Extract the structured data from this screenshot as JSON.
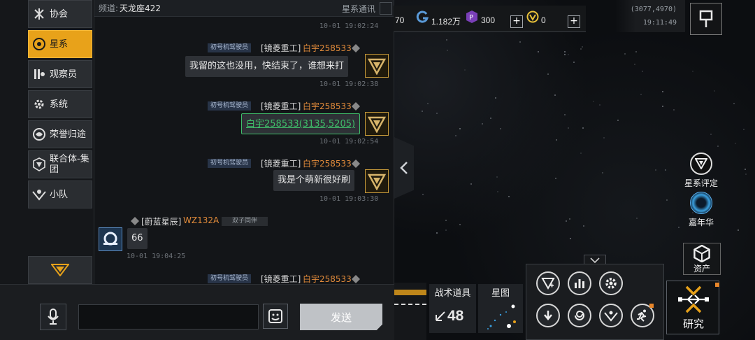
{
  "sidebar": {
    "items": [
      {
        "label": "协会",
        "icon": "alliance-star-icon"
      },
      {
        "label": "星系",
        "icon": "galaxy-icon"
      },
      {
        "label": "观察员",
        "icon": "observer-icon"
      },
      {
        "label": "系统",
        "icon": "gear-icon"
      },
      {
        "label": "荣誉归途",
        "icon": "honor-icon"
      },
      {
        "label": "联合体-集团",
        "icon": "union-icon"
      },
      {
        "label": "小队",
        "icon": "squad-icon"
      }
    ],
    "active_index": 1
  },
  "chat": {
    "channel_prefix": "频道:",
    "channel_name": "天龙座422",
    "channel_type": "星系通讯",
    "messages": [
      {
        "time": "10-01 19:02:24"
      },
      {
        "rank": "初号机驾驶员",
        "guild": "[镜菱重工]",
        "user": "白宇258533",
        "text": "我留的这也没用，快结束了，谁想来打",
        "time": "10-01 19:02:38"
      },
      {
        "rank": "初号机驾驶员",
        "guild": "[镜菱重工]",
        "user": "白宇258533",
        "text": "白宇258533(3135,5205)",
        "time": "10-01 19:02:54"
      },
      {
        "rank": "初号机驾驶员",
        "guild": "[镜菱重工]",
        "user": "白宇258533",
        "text": "我是个萌新很好刷",
        "time": "10-01 19:03:30"
      },
      {
        "guild": "[蔚蓝星辰]",
        "user": "WZ132A",
        "rank": "双子同伴",
        "text": "66",
        "time": "10-01 19:04:25"
      },
      {
        "rank": "初号机驾驶员",
        "guild": "[镜菱重工]",
        "user": "白宇258533"
      }
    ],
    "send_label": "发送",
    "input_value": ""
  },
  "resources": {
    "partial_value": "70",
    "g_value": "1.182万",
    "p_value": "300",
    "v_value": "0",
    "plus": "+"
  },
  "location": {
    "coords": "(3077,4970)",
    "time": "19:11:49"
  },
  "side": {
    "rating_label": "星系评定",
    "carnival_label": "嘉年华",
    "assets_label": "资产"
  },
  "bottom": {
    "tactical_label": "战术道具",
    "tactical_count": "48",
    "starmap_label": "星图",
    "research_label": "研究"
  },
  "colors": {
    "accent": "#e8a21a",
    "username": "#e08a3a",
    "link": "#3fbf6a"
  }
}
